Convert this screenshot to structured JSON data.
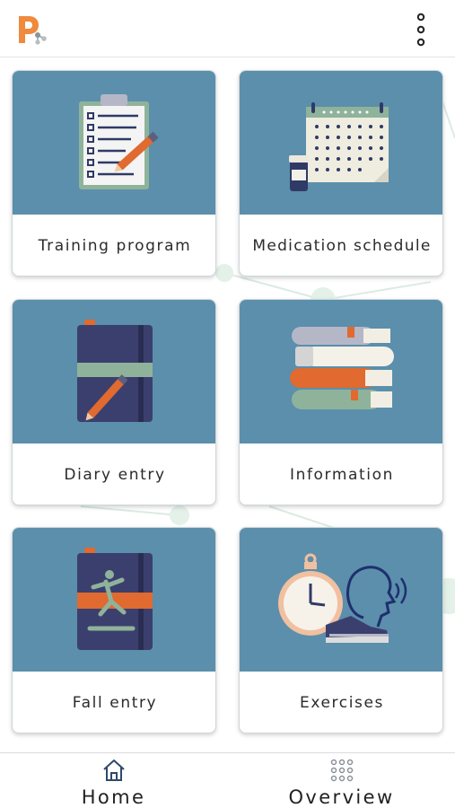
{
  "app_bar": {
    "logo": "p-logo-icon",
    "menu": "more-vert-icon"
  },
  "colors": {
    "accent": "#f08a3c",
    "card_illustration_bg": "#5b8fac",
    "navy": "#2f3a66",
    "nav_icon": "#2e4a6b"
  },
  "tiles": [
    {
      "label": "Training program",
      "icon": "clipboard-checklist-icon"
    },
    {
      "label": "Medication schedule",
      "icon": "calendar-pills-icon"
    },
    {
      "label": "Diary entry",
      "icon": "diary-notebook-icon"
    },
    {
      "label": "Information",
      "icon": "book-stack-icon"
    },
    {
      "label": "Fall entry",
      "icon": "fall-notebook-icon"
    },
    {
      "label": "Exercises",
      "icon": "stopwatch-voice-shoe-icon"
    }
  ],
  "bottom_nav": [
    {
      "label": "Home",
      "icon": "home-icon"
    },
    {
      "label": "Overview",
      "icon": "grid-dots-icon"
    }
  ]
}
